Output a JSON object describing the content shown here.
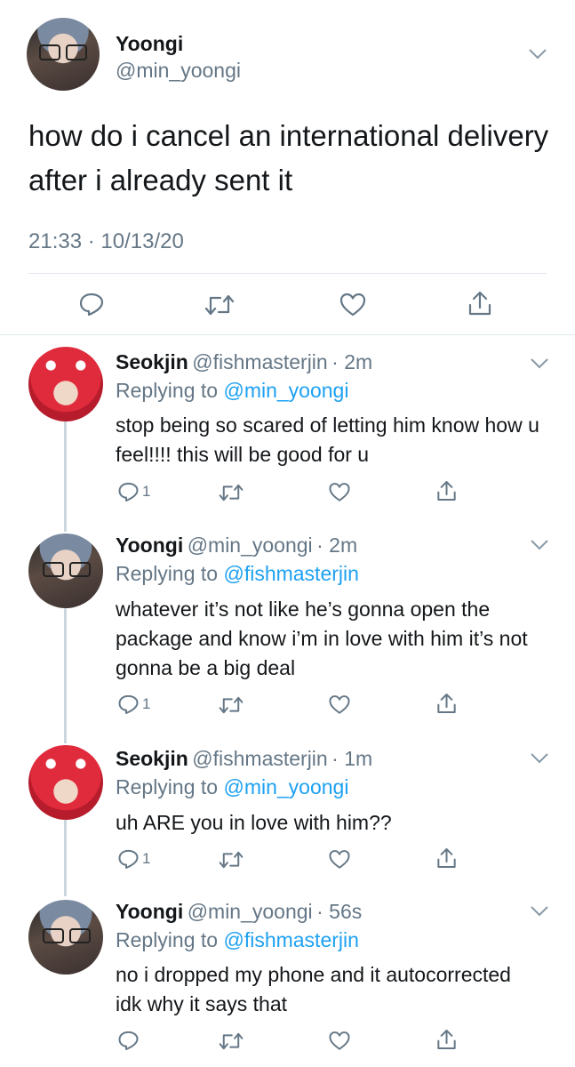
{
  "main_tweet": {
    "display_name": "Yoongi",
    "handle": "@min_yoongi",
    "text": "how do i cancel an international delivery after i already sent it",
    "timestamp": "21:33 · 10/13/20"
  },
  "replies": [
    {
      "display_name": "Seokjin",
      "handle": "@fishmasterjin",
      "time": "· 2m",
      "replying_prefix": "Replying to ",
      "replying_to": "@min_yoongi",
      "text": "stop being so scared of letting him know how u feel!!!! this will be good for u",
      "reply_count": "1"
    },
    {
      "display_name": "Yoongi",
      "handle": "@min_yoongi",
      "time": "· 2m",
      "replying_prefix": "Replying to ",
      "replying_to": "@fishmasterjin",
      "text": "whatever it’s not like he’s gonna open the package and know i’m in love with him it’s not gonna be a big deal",
      "reply_count": "1"
    },
    {
      "display_name": "Seokjin",
      "handle": "@fishmasterjin",
      "time": "· 1m",
      "replying_prefix": "Replying to ",
      "replying_to": "@min_yoongi",
      "text": "uh ARE you in love with him??",
      "reply_count": "1"
    },
    {
      "display_name": "Yoongi",
      "handle": "@min_yoongi",
      "time": "· 56s",
      "replying_prefix": "Replying to ",
      "replying_to": "@fishmasterjin",
      "text": "no i dropped my phone and it autocorrected idk why it says that",
      "reply_count": ""
    }
  ],
  "icons": {
    "reply": "reply-icon",
    "retweet": "retweet-icon",
    "like": "like-icon",
    "share": "share-icon",
    "more": "chevron-down-icon"
  },
  "colors": {
    "text": "#14171a",
    "secondary": "#657786",
    "link": "#1da1f2",
    "divider": "#e1e8ed"
  }
}
